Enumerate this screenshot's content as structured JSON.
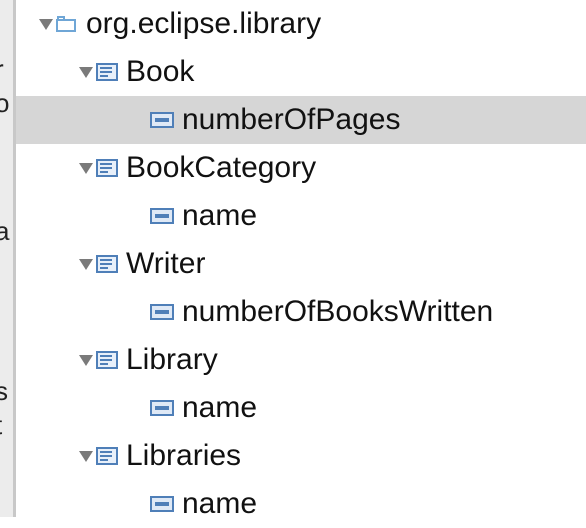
{
  "left_panel": {
    "fragments": [
      {
        "text": "r"
      },
      {
        "text": "o"
      },
      {
        "text": "a"
      },
      {
        "text": ":"
      },
      {
        "text": "s"
      },
      {
        "text": "t"
      }
    ]
  },
  "tree": {
    "package": {
      "label": "org.eclipse.library",
      "icon": "package-icon",
      "expanded": true
    },
    "rows": [
      {
        "kind": "class",
        "label": "Book",
        "icon": "eclass-icon",
        "expanded": true
      },
      {
        "kind": "attribute",
        "label": "numberOfPages",
        "icon": "eattribute-icon",
        "selected": true
      },
      {
        "kind": "class",
        "label": "BookCategory",
        "icon": "eclass-icon",
        "expanded": true
      },
      {
        "kind": "attribute",
        "label": "name",
        "icon": "eattribute-icon"
      },
      {
        "kind": "class",
        "label": "Writer",
        "icon": "eclass-icon",
        "expanded": true
      },
      {
        "kind": "attribute",
        "label": "numberOfBooksWritten",
        "icon": "eattribute-icon"
      },
      {
        "kind": "class",
        "label": "Library",
        "icon": "eclass-icon",
        "expanded": true
      },
      {
        "kind": "attribute",
        "label": "name",
        "icon": "eattribute-icon"
      },
      {
        "kind": "class",
        "label": "Libraries",
        "icon": "eclass-icon",
        "expanded": true
      },
      {
        "kind": "attribute",
        "label": "name",
        "icon": "eattribute-icon"
      }
    ]
  },
  "colors": {
    "selection": "#d6d6d6",
    "package_icon": "#6fa6d6",
    "class_icon": "#4f7fb8",
    "twisty": "#7a7a7a"
  }
}
